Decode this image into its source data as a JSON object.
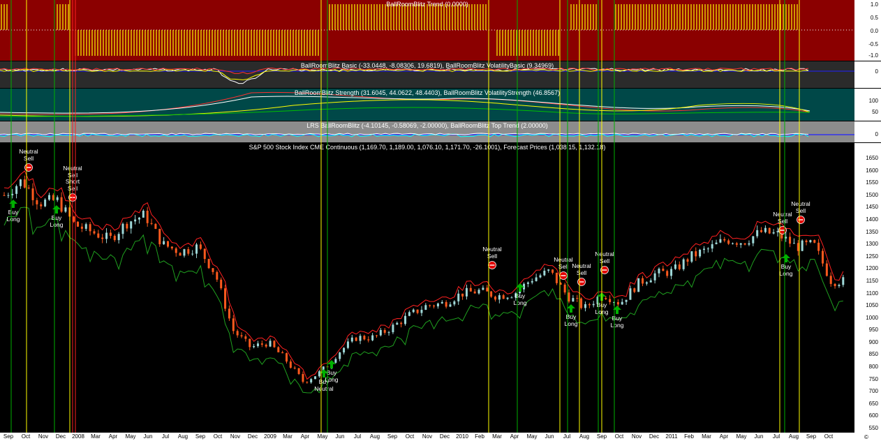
{
  "panes": {
    "trend": {
      "title": "BallRoomBlitz Trend (0.0000)",
      "ticks": [
        "1.0",
        "0.5",
        "0.0",
        "-0.5",
        "-1.0"
      ],
      "bg": "#8b0000"
    },
    "basic": {
      "title": "BallRoomBlitz Basic (-33.0448, -8.08306, 19.6819), BallRoomBlitz VolatilityBasic (9.34969)",
      "ticks": [
        "0"
      ],
      "bg": "#2b2b2b"
    },
    "strength": {
      "title": "BallRoomBlitz Strength (31.6045, 44.0622, 48.4403), BallRoomBlitz VolatilityStrength (46.8567)",
      "ticks": [
        "100",
        "50"
      ],
      "bg": "#004848"
    },
    "lrs": {
      "title": "LRS BallRoomBlitz (-4.10145, -0.58069, -2.00000), BallRoomBlitz Top Trend (2.00000)",
      "ticks": [
        "0"
      ],
      "bg": "#8c8c8c"
    }
  },
  "main": {
    "title": "S&P 500 Stock Index CME Continuous (1,169.70, 1,189.00, 1,076.10, 1,171.70, -26.1001), Forecast Prices (1,038.15, 1,132.18)",
    "ticks": [
      "1650",
      "1600",
      "1550",
      "1500",
      "1450",
      "1400",
      "1350",
      "1300",
      "1250",
      "1200",
      "1150",
      "1100",
      "1050",
      "1000",
      "950",
      "900",
      "850",
      "800",
      "750",
      "700",
      "650",
      "600",
      "550"
    ]
  },
  "annotations": [
    {
      "text": [
        "Neutral",
        "Sell"
      ],
      "kind": "sell"
    },
    {
      "text": [
        "Buy",
        "Long"
      ],
      "kind": "buy"
    },
    {
      "text": [
        "Neutral",
        "Sell",
        "Short",
        "Sell"
      ],
      "kind": "sell"
    },
    {
      "text": [
        "Buy",
        "Long"
      ],
      "kind": "buy"
    },
    {
      "text": [
        "Buy",
        "Neutral"
      ],
      "kind": "buy"
    },
    {
      "text": [
        "Buy",
        "Long"
      ],
      "kind": "buy"
    },
    {
      "text": [
        "Neutral",
        "Sell"
      ],
      "kind": "sell"
    },
    {
      "text": [
        "Buy",
        "Long"
      ],
      "kind": "buy"
    },
    {
      "text": [
        "Neutral",
        "Sell"
      ],
      "kind": "sell"
    },
    {
      "text": [
        "Buy",
        "Long"
      ],
      "kind": "buy"
    },
    {
      "text": [
        "Neutral",
        "Sell"
      ],
      "kind": "sell"
    },
    {
      "text": [
        "Neutral",
        "Sell"
      ],
      "kind": "sell"
    },
    {
      "text": [
        "Buy",
        "Long"
      ],
      "kind": "buy"
    },
    {
      "text": [
        "Buy",
        "Long"
      ],
      "kind": "buy"
    },
    {
      "text": [
        "Neutral",
        "Sell"
      ],
      "kind": "sell"
    },
    {
      "text": [
        "Neutral",
        "Sell"
      ],
      "kind": "sell"
    },
    {
      "text": [
        "Buy",
        "Long"
      ],
      "kind": "buy"
    }
  ],
  "x_labels": [
    "Sep",
    "Oct",
    "Nov",
    "Dec",
    "2008",
    "Mar",
    "Apr",
    "May",
    "Jun",
    "Jul",
    "Aug",
    "Sep",
    "Oct",
    "Nov",
    "Dec",
    "2009",
    "Mar",
    "Apr",
    "May",
    "Jun",
    "Jul",
    "Aug",
    "Sep",
    "Oct",
    "Nov",
    "Dec",
    "2010",
    "Feb",
    "Mar",
    "Apr",
    "May",
    "Jun",
    "Jul",
    "Aug",
    "Sep",
    "Oct",
    "Nov",
    "Dec",
    "2011",
    "Feb",
    "Mar",
    "Apr",
    "May",
    "Jun",
    "Jul",
    "Aug",
    "Sep",
    "Oct"
  ],
  "colors": {
    "up_candle": "#9fd8d8",
    "down_candle": "#ff5a1e",
    "upper_band": "#ff2020",
    "lower_band": "#1fa01f",
    "yellow_line": "#ffff00",
    "green_line": "#00a000"
  },
  "chart_data": {
    "type": "candlestick",
    "title": "S&P 500 Stock Index CME Continuous (1,169.70, 1,189.00, 1,076.10, 1,171.70, -26.1001), Forecast Prices (1,038.15, 1,132.18)",
    "x": [
      "Sep 2007",
      "Oct 2007",
      "Nov 2007",
      "Dec 2007",
      "Jan 2008",
      "Feb 2008",
      "Mar 2008",
      "Apr 2008",
      "May 2008",
      "Jun 2008",
      "Jul 2008",
      "Aug 2008",
      "Sep 2008",
      "Oct 2008",
      "Nov 2008",
      "Dec 2008",
      "Jan 2009",
      "Feb 2009",
      "Mar 2009",
      "Apr 2009",
      "May 2009",
      "Jun 2009",
      "Jul 2009",
      "Aug 2009",
      "Sep 2009",
      "Oct 2009",
      "Nov 2009",
      "Dec 2009",
      "Jan 2010",
      "Feb 2010",
      "Mar 2010",
      "Apr 2010",
      "May 2010",
      "Jun 2010",
      "Jul 2010",
      "Aug 2010",
      "Sep 2010",
      "Oct 2010",
      "Nov 2010",
      "Dec 2010",
      "Jan 2011",
      "Feb 2011",
      "Mar 2011",
      "Apr 2011",
      "May 2011",
      "Jun 2011",
      "Jul 2011",
      "Aug 2011"
    ],
    "close": [
      1500,
      1560,
      1470,
      1480,
      1380,
      1350,
      1320,
      1390,
      1420,
      1300,
      1270,
      1290,
      1180,
      950,
      880,
      900,
      830,
      740,
      780,
      860,
      920,
      920,
      960,
      1010,
      1050,
      1060,
      1100,
      1110,
      1090,
      1100,
      1160,
      1190,
      1090,
      1040,
      1100,
      1060,
      1140,
      1180,
      1190,
      1250,
      1280,
      1320,
      1310,
      1350,
      1340,
      1290,
      1300,
      1150
    ],
    "ylim": [
      550,
      1650
    ]
  }
}
